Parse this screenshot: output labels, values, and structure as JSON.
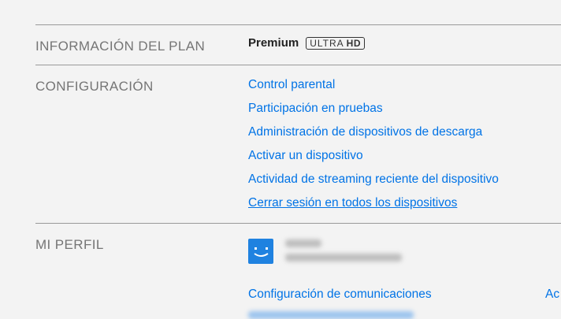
{
  "plan": {
    "section_title": "INFORMACIÓN DEL PLAN",
    "name": "Premium",
    "badge_text": "ULTRA",
    "badge_hd": "HD"
  },
  "settings": {
    "section_title": "CONFIGURACIÓN",
    "links": [
      "Control parental",
      "Participación en pruebas",
      "Administración de dispositivos de descarga",
      "Activar un dispositivo",
      "Actividad de streaming reciente del dispositivo",
      "Cerrar sesión en todos los dispositivos"
    ]
  },
  "profile": {
    "section_title": "MI PERFIL",
    "avatar_icon": "smiley-face-icon",
    "links": [
      "Configuración de comunicaciones",
      "Ac"
    ]
  },
  "colors": {
    "link": "#0073e6",
    "avatar": "#1f82e0",
    "section_title": "#757575"
  }
}
